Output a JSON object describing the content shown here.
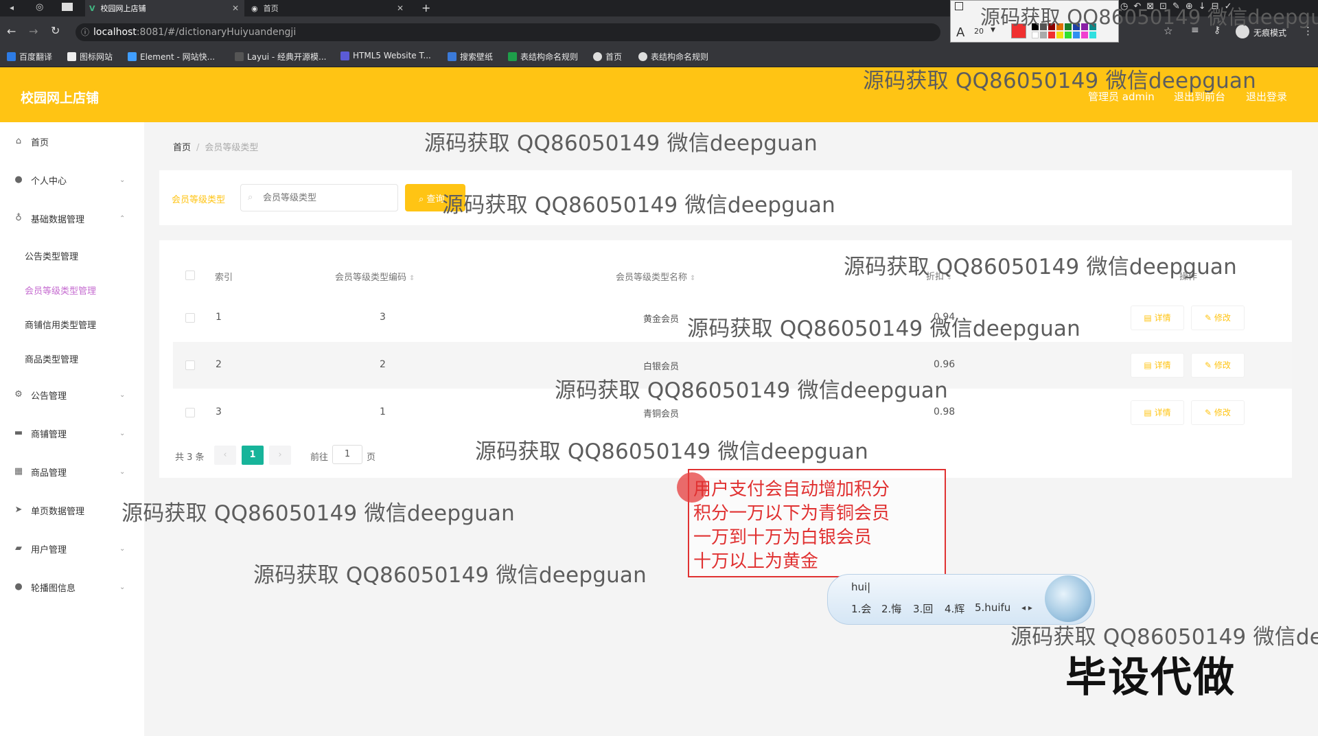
{
  "browser": {
    "tabs": [
      {
        "title": "校园网上店铺",
        "active": true
      },
      {
        "title": "首页",
        "active": false
      }
    ],
    "url_host": "localhost",
    "url_path": ":8081/#/dictionaryHuiyuandengji",
    "bookmarks": [
      "百度翻译",
      "图标网站",
      "Element - 网站快...",
      "Layui - 经典开源模...",
      "HTML5 Website T...",
      "搜索壁纸",
      "表结构命名规则",
      "首页",
      "表结构命名规则"
    ],
    "incognito": "无痕模式",
    "font_size_value": "20"
  },
  "app": {
    "brand": "校园网上店铺",
    "header_links": [
      "管理员 admin",
      "退出到前台",
      "退出登录"
    ],
    "accent": "#ffc414"
  },
  "sidebar": {
    "items": [
      {
        "label": "首页",
        "icon": "home-icon"
      },
      {
        "label": "个人中心",
        "icon": "user-icon"
      },
      {
        "label": "基础数据管理",
        "icon": "mic-icon"
      },
      {
        "label": "公告管理",
        "icon": "gear-icon"
      },
      {
        "label": "商铺管理",
        "icon": "chat-icon"
      },
      {
        "label": "商品管理",
        "icon": "grid-icon"
      },
      {
        "label": "单页数据管理",
        "icon": "send-icon"
      },
      {
        "label": "用户管理",
        "icon": "briefcase-icon"
      },
      {
        "label": "轮播图信息",
        "icon": "pin-icon"
      }
    ],
    "subitems": [
      "公告类型管理",
      "会员等级类型管理",
      "商铺信用类型管理",
      "商品类型管理"
    ],
    "active_sub": "会员等级类型管理"
  },
  "breadcrumb": {
    "home": "首页",
    "sep": "/",
    "current": "会员等级类型"
  },
  "search": {
    "label": "会员等级类型",
    "placeholder": "会员等级类型",
    "button_label": "查询"
  },
  "table": {
    "headers": [
      "索引",
      "会员等级类型编码",
      "会员等级类型名称",
      "折扣",
      "操作"
    ],
    "rows": [
      {
        "index": "1",
        "code": "3",
        "name": "黄金会员",
        "discount": "0.94"
      },
      {
        "index": "2",
        "code": "2",
        "name": "白银会员",
        "discount": "0.96"
      },
      {
        "index": "3",
        "code": "1",
        "name": "青铜会员",
        "discount": "0.98"
      }
    ],
    "detail_label": "详情",
    "edit_label": "修改"
  },
  "pagination": {
    "total": "共 3 条",
    "prev": "‹",
    "current": "1",
    "next": "›",
    "goto_label": "前往",
    "goto_value": "1",
    "page_suffix": "页"
  },
  "watermark": "源码获取 QQ86050149 微信deepguan",
  "watermark_cut_top": "源码获取 QQ86050149 微信deepgu",
  "watermark_cut_right": "源码获取 QQ86050149 微信deep",
  "note_lines": [
    "用户支付会自动增加积分",
    "积分一万以下为青铜会员",
    "一万到十万为白银会员",
    "十万以上为黄金"
  ],
  "ime": {
    "input": "hui|",
    "candidates": [
      "1.会",
      "2.悔",
      "3.回",
      "4.辉",
      "5.huifu"
    ]
  },
  "big_ad": "毕设代做"
}
